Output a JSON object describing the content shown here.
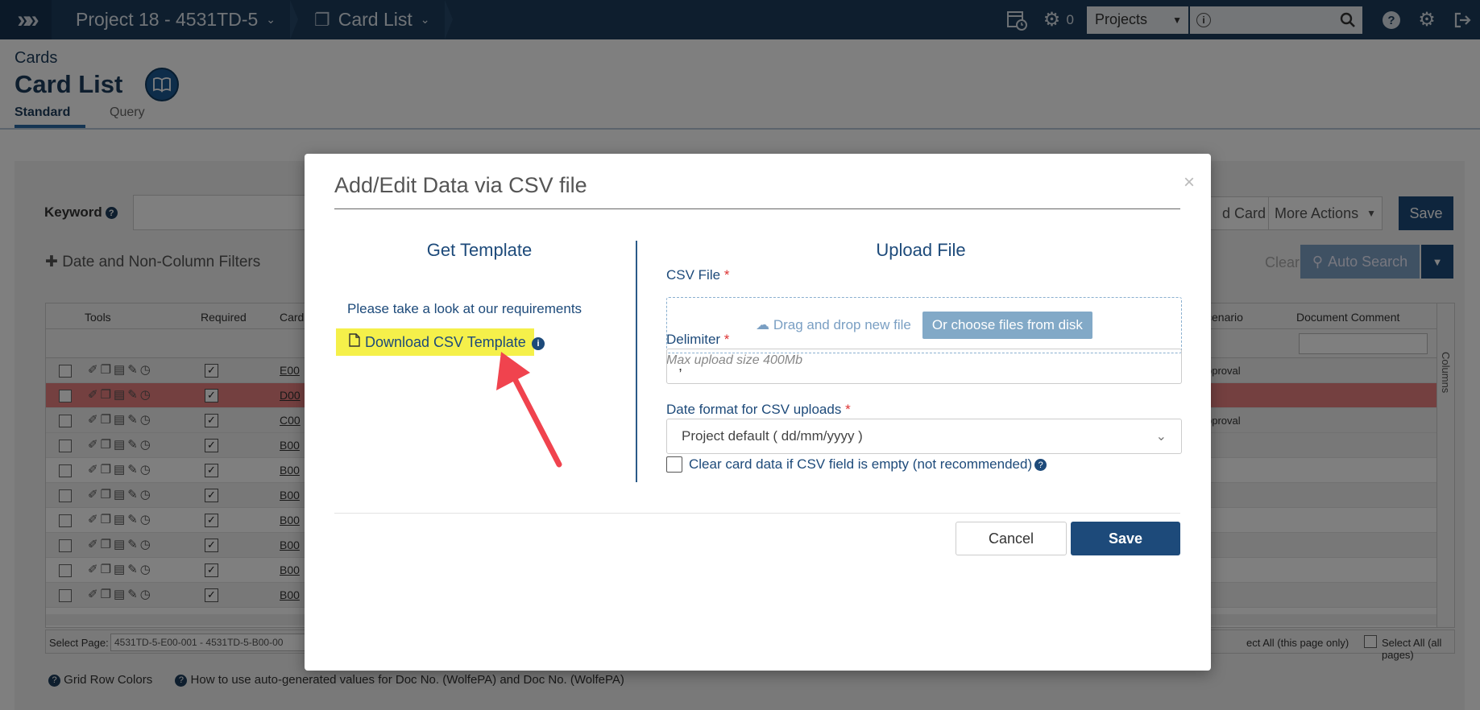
{
  "topbar": {
    "logo_glyph": "»",
    "project_crumb": "Project 18 - 4531TD-5",
    "page_crumb": "Card List",
    "chevron": "⌄",
    "jobs_count": "0",
    "projects_select": "Projects",
    "search_placeholder": "",
    "icons": [
      "calendar-clock-icon",
      "gears-icon",
      "help-icon",
      "gear-icon",
      "logout-icon"
    ]
  },
  "header": {
    "eyebrow": "Cards",
    "title": "Card List",
    "tabs": [
      {
        "label": "Standard",
        "active": true
      },
      {
        "label": "Query",
        "active": false
      }
    ]
  },
  "background": {
    "keyword_label": "Keyword",
    "filters_link": "Date and Non-Column Filters",
    "add_card_label": "d Card",
    "more_actions_label": "More Actions",
    "save_label": "Save",
    "clear_label": "Clear",
    "auto_search_label": "Auto Search",
    "grid_headers": {
      "tools": "Tools",
      "required": "Required",
      "card": "Card",
      "scenario": "cenario",
      "doc_comment": "Document Comment"
    },
    "rows": [
      {
        "code": "E00",
        "scenario": "pproval",
        "style": "alt"
      },
      {
        "code": "D00",
        "scenario": "",
        "style": "hl"
      },
      {
        "code": "C00",
        "scenario": "pproval",
        "style": "alt"
      },
      {
        "code": "B00",
        "scenario": "",
        "style": "alt"
      },
      {
        "code": "B00",
        "scenario": "",
        "style": ""
      },
      {
        "code": "B00",
        "scenario": "",
        "style": "alt"
      },
      {
        "code": "B00",
        "scenario": "",
        "style": ""
      },
      {
        "code": "B00",
        "scenario": "",
        "style": "alt"
      },
      {
        "code": "B00",
        "scenario": "",
        "style": ""
      },
      {
        "code": "B00",
        "scenario": "",
        "style": "alt"
      }
    ],
    "columns_label": "Columns",
    "select_page_label": "Select Page:",
    "select_page_value": "4531TD-5-E00-001 - 4531TD-5-B00-00",
    "select_all_page": "ect All (this page only)",
    "select_all_pages": "Select All (all pages)",
    "help_links": [
      "Grid Row Colors",
      "How to use auto-generated values for Doc No. (WolfePA) and Doc No. (WolfePA)"
    ]
  },
  "modal": {
    "title": "Add/Edit Data via CSV file",
    "close": "×",
    "left_heading": "Get Template",
    "requirements_text": "Please take a look at our requirements",
    "download_label": "Download CSV Template",
    "right_heading": "Upload File",
    "csv_file_label": "CSV File",
    "required_marker": "*",
    "drag_drop_label": "Drag and drop new file",
    "choose_files_label": "Or choose files from disk",
    "max_upload": "Max upload size 400Mb",
    "delimiter_label": "Delimiter",
    "delimiter_value": ",",
    "date_format_label": "Date format for CSV uploads",
    "date_format_value": "Project default ( dd/mm/yyyy )",
    "clear_data_label": "Clear card data if CSV field is empty (not recommended)",
    "cancel_label": "Cancel",
    "save_label": "Save",
    "annotation_color": "#f0434e",
    "highlight_color": "#f5f04a",
    "brand_color": "#1d4a7a"
  }
}
